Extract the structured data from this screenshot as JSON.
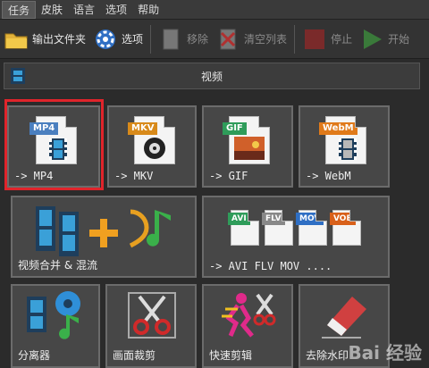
{
  "menu": [
    "任务",
    "皮肤",
    "语言",
    "选项",
    "帮助"
  ],
  "toolbar": {
    "output_folder": "输出文件夹",
    "options": "选项",
    "remove": "移除",
    "clear_list": "清空列表",
    "stop": "停止",
    "start": "开始"
  },
  "section": {
    "title": "视频"
  },
  "tiles": {
    "mp4": {
      "badge": "MP4",
      "label": "-> MP4"
    },
    "mkv": {
      "badge": "MKV",
      "label": "-> MKV"
    },
    "gif": {
      "badge": "GIF",
      "label": "-> GIF"
    },
    "webm": {
      "badge": "WebM",
      "label": "-> WebM"
    },
    "merge": {
      "label": "视频合并 & 混流"
    },
    "multi": {
      "label": "-> AVI FLV MOV ....",
      "badges": [
        "AVI",
        "FLV",
        "MOV",
        "VOB"
      ]
    },
    "split": {
      "label": "分离器"
    },
    "crop": {
      "label": "画面裁剪"
    },
    "quickcut": {
      "label": "快速剪辑"
    },
    "watermark": {
      "label": "去除水印"
    }
  },
  "watermark_text": "Bai 经验",
  "colors": {
    "highlight": "#e0242b",
    "mp4_badge": "#4a7fbf",
    "mkv_badge": "#d88a1a",
    "gif_badge": "#2f9c5a",
    "webm_badge": "#e07a1a"
  }
}
